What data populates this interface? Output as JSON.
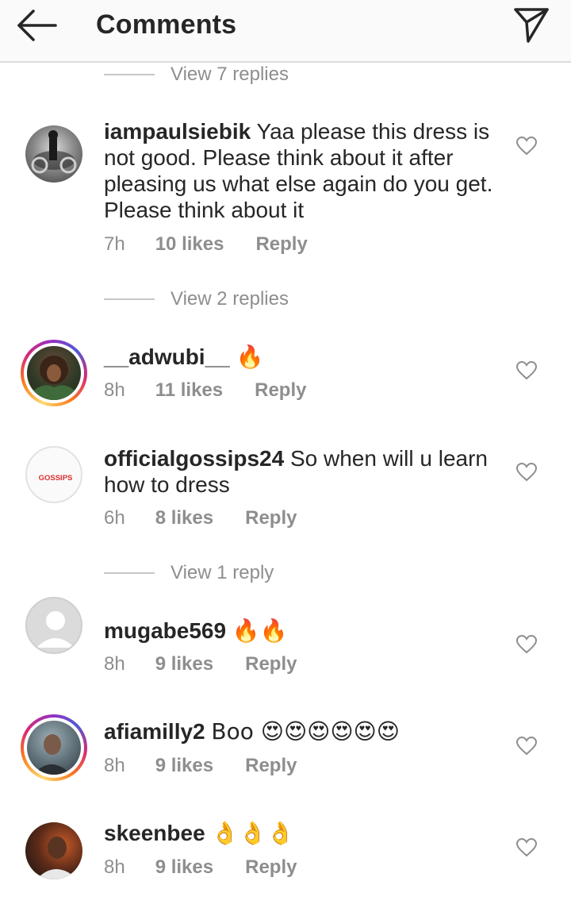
{
  "header": {
    "title": "Comments",
    "back_icon": "arrow-left-icon",
    "send_icon": "paper-plane-icon"
  },
  "view_replies": [
    {
      "label": "View 7 replies"
    },
    {
      "label": "View 2 replies"
    },
    {
      "label": "View 1 reply"
    }
  ],
  "comments": [
    {
      "username": "iampaulsiebik",
      "text": "Yaa please this dress is not good. Please think about it after pleasing us what else again do you get. Please think about it",
      "time": "7h",
      "likes": "10 likes",
      "reply": "Reply",
      "story_ring": false
    },
    {
      "username": "__adwubi__",
      "text": "🔥",
      "time": "8h",
      "likes": "11 likes",
      "reply": "Reply",
      "story_ring": true
    },
    {
      "username": "officialgossips24",
      "text": "So when will u learn how to dress",
      "time": "6h",
      "likes": "8 likes",
      "reply": "Reply",
      "story_ring": false,
      "avatar_logo": "GOSSIPS"
    },
    {
      "username": "mugabe569",
      "text": "🔥🔥",
      "time": "8h",
      "likes": "9 likes",
      "reply": "Reply",
      "story_ring": false
    },
    {
      "username": "afiamilly2",
      "text": "Boo 😍😍😍😍😍😍",
      "time": "8h",
      "likes": "9 likes",
      "reply": "Reply",
      "story_ring": true
    },
    {
      "username": "skeenbee",
      "text": "👌👌👌",
      "time": "8h",
      "likes": "9 likes",
      "reply": "Reply",
      "story_ring": false
    }
  ],
  "icons": {
    "like": "heart-outline-icon"
  },
  "colors": {
    "secondary_text": "#8e8e8e",
    "primary_text": "#262626",
    "fire": "#f7a21b",
    "heart_eyes_face": "#ffc83d"
  }
}
